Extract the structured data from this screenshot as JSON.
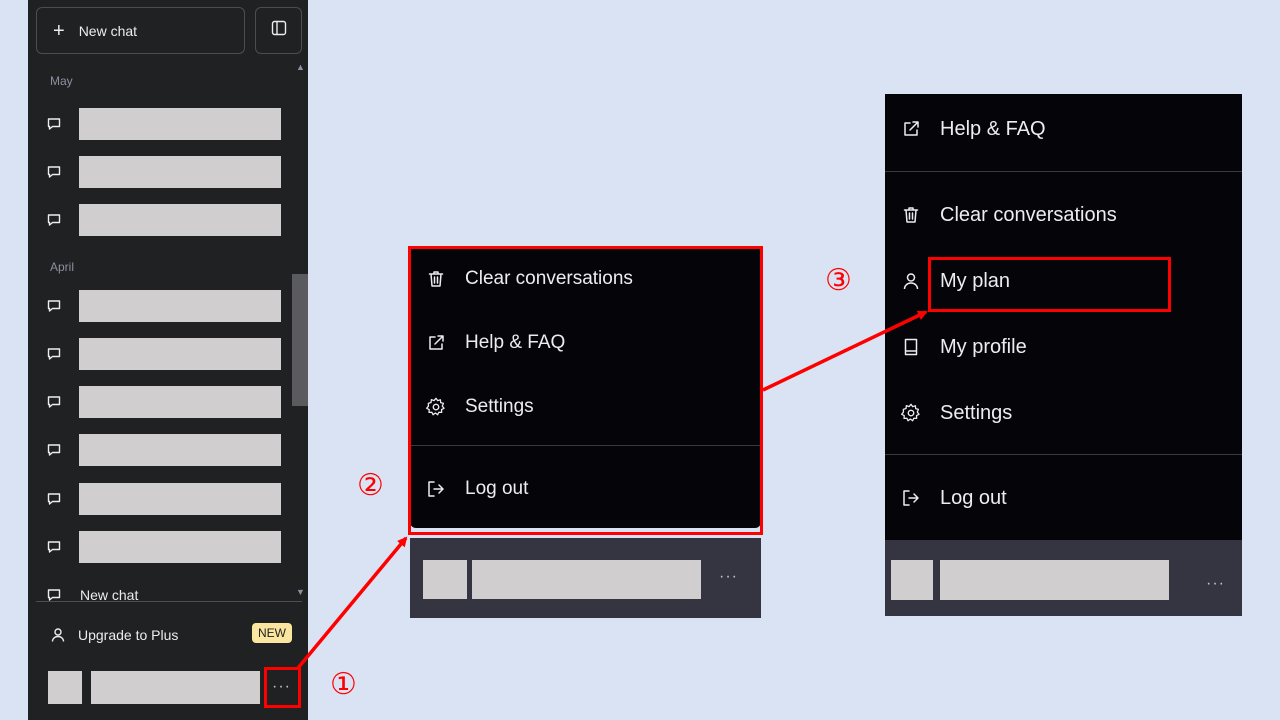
{
  "sidebar": {
    "new_chat_label": "New chat",
    "sections": [
      {
        "label": "May"
      },
      {
        "label": "April"
      }
    ],
    "bottom_chat_label": "New chat",
    "upgrade_label": "Upgrade to Plus",
    "upgrade_badge": "NEW",
    "more_label": "···"
  },
  "menu_a": {
    "items": [
      {
        "label": "Clear conversations",
        "icon": "trash-icon"
      },
      {
        "label": "Help & FAQ",
        "icon": "external-link-icon"
      },
      {
        "label": "Settings",
        "icon": "gear-icon"
      },
      {
        "label": "Log out",
        "icon": "logout-icon"
      }
    ],
    "more_label": "···"
  },
  "menu_b": {
    "items": [
      {
        "label": "Help & FAQ",
        "icon": "external-link-icon"
      },
      {
        "label": "Clear conversations",
        "icon": "trash-icon"
      },
      {
        "label": "My plan",
        "icon": "user-icon"
      },
      {
        "label": "My profile",
        "icon": "book-icon"
      },
      {
        "label": "Settings",
        "icon": "gear-icon"
      },
      {
        "label": "Log out",
        "icon": "logout-icon"
      }
    ],
    "more_label": "···"
  },
  "annotations": {
    "step1": "①",
    "step2": "②",
    "step3": "③"
  },
  "colors": {
    "background": "#dae3f3",
    "sidebar": "#202123",
    "menu": "#050509",
    "highlight": "#ff0000",
    "badge": "#fae69e"
  }
}
